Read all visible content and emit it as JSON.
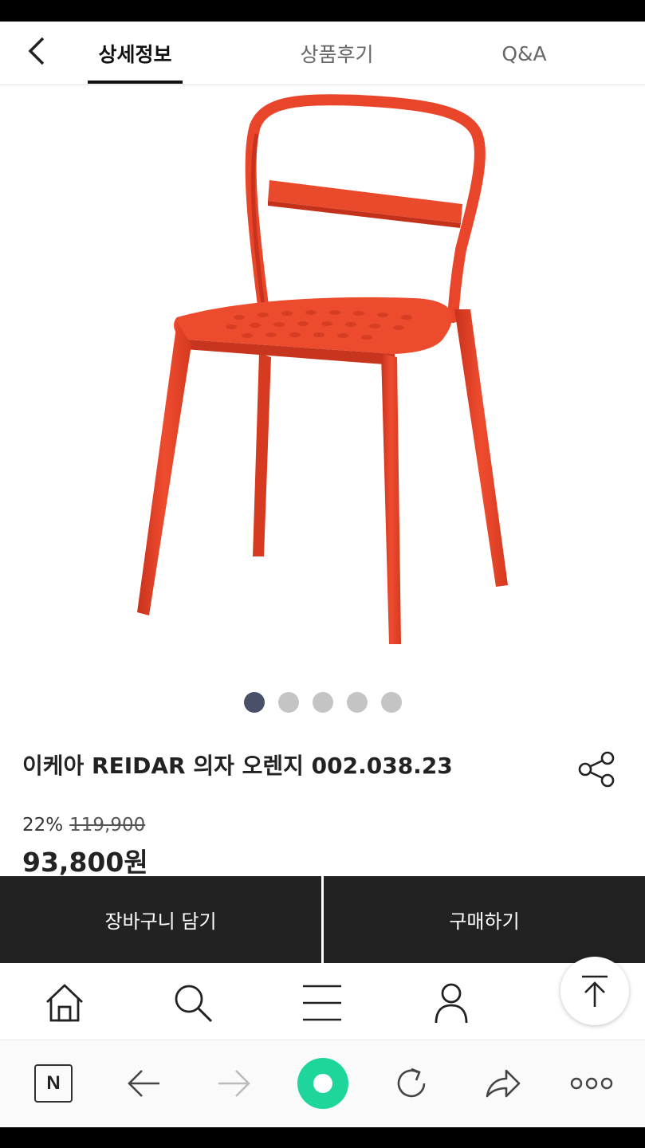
{
  "tabs": [
    {
      "label": "상세정보",
      "active": true
    },
    {
      "label": "상품후기",
      "active": false
    },
    {
      "label": "Q&A",
      "active": false
    }
  ],
  "product": {
    "title": "이케아 REIDAR 의자 오렌지 002.038.23",
    "discount": "22%",
    "original_price": "119,900",
    "price": "93,800원",
    "image_color": "#e8452a",
    "image_count": 5,
    "current_image": 1
  },
  "actions": {
    "cart_label": "장바구니 담기",
    "buy_label": "구매하기"
  },
  "shop_nav": [
    "home-icon",
    "search-icon",
    "menu-icon",
    "user-icon"
  ],
  "browser_bar": {
    "naver_letter": "N",
    "icons": [
      "naver-icon",
      "back-arrow-icon",
      "forward-arrow-icon",
      "green-dot-icon",
      "refresh-icon",
      "share-arrow-icon",
      "more-icon"
    ]
  },
  "colors": {
    "accent_dark": "#222222",
    "active_dot": "#4a5068",
    "brand_green": "#1ed69c"
  }
}
